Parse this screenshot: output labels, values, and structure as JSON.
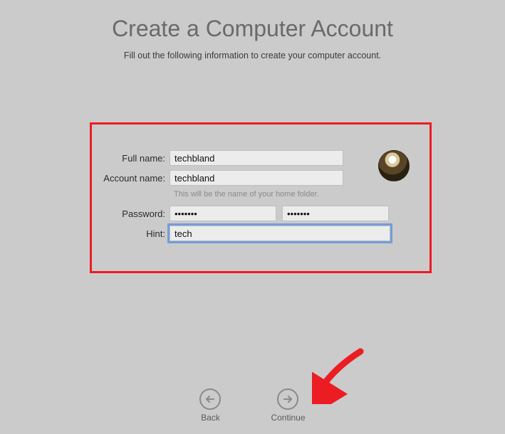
{
  "title": "Create a Computer Account",
  "subtitle": "Fill out the following information to create your computer account.",
  "labels": {
    "fullName": "Full name:",
    "accountName": "Account name:",
    "password": "Password:",
    "hint": "Hint:"
  },
  "values": {
    "fullName": "techbland",
    "accountName": "techbland",
    "password": "•••••••",
    "passwordVerify": "•••••••",
    "hint": "tech"
  },
  "helper": {
    "accountName": "This will be the name of your home folder."
  },
  "nav": {
    "back": "Back",
    "continue": "Continue"
  },
  "avatar": {
    "name": "eagle-avatar"
  }
}
